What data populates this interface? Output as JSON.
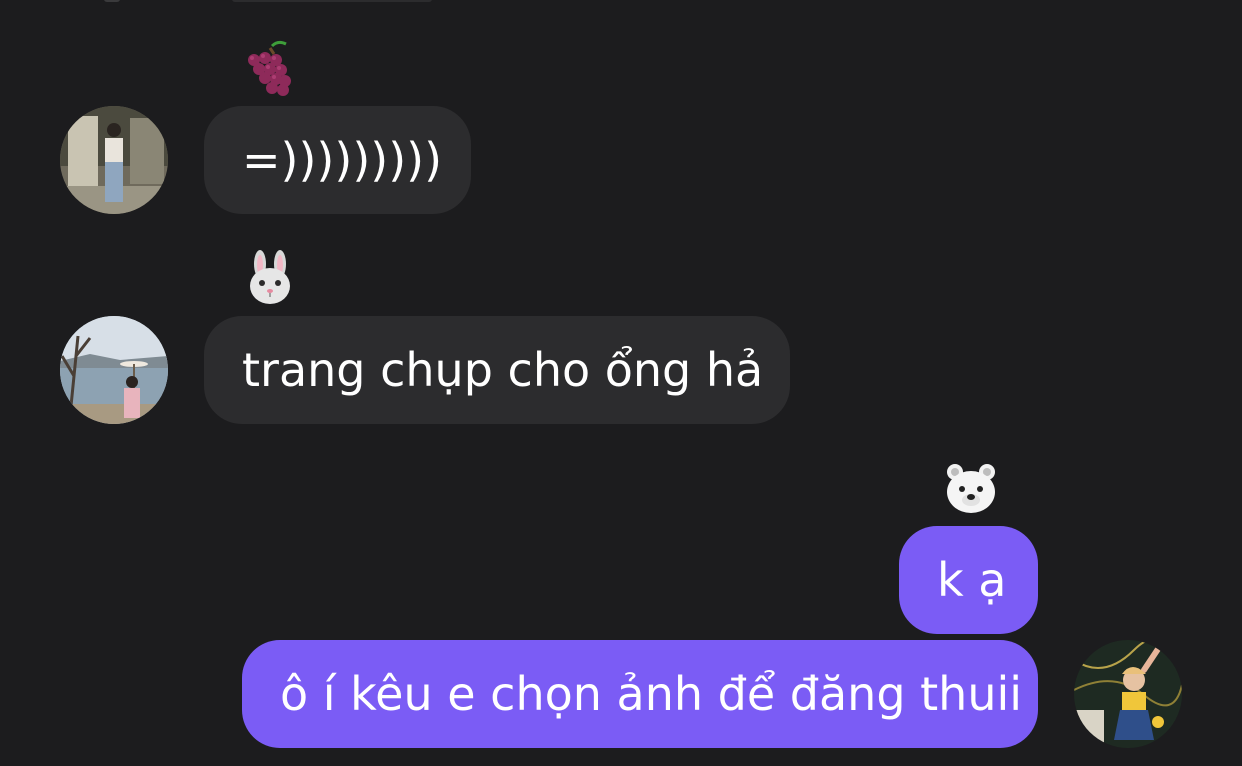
{
  "messages": [
    {
      "direction": "incoming",
      "sender_emoji_icon": "grapes-icon",
      "avatar": "avatar-woman-shop",
      "text": "=)))))))))"
    },
    {
      "direction": "incoming",
      "sender_emoji_icon": "rabbit-icon",
      "avatar": "avatar-woman-lake",
      "text": "trang chụp cho ổng hả"
    },
    {
      "direction": "outgoing",
      "sender_emoji_icon": "polar-bear-icon",
      "text": "k ạ"
    },
    {
      "direction": "outgoing",
      "avatar": "avatar-woman-yellow-top",
      "text": "ô í kêu e chọn ảnh để đăng thuii"
    }
  ],
  "colors": {
    "background": "#1c1c1e",
    "incoming_bubble": "#2c2c2e",
    "outgoing_bubble": "#7b5cf5",
    "text": "#ffffff"
  }
}
